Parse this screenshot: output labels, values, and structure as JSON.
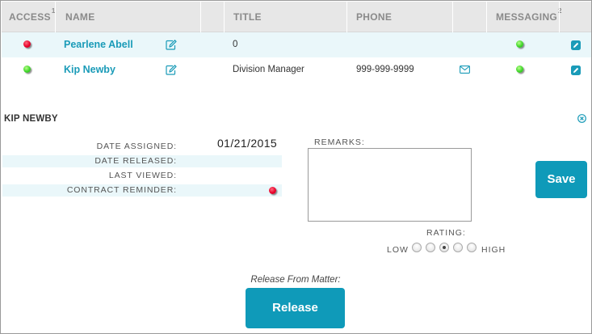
{
  "table": {
    "headers": {
      "access": "ACCESS",
      "access_sup": "1",
      "name": "NAME",
      "title": "TITLE",
      "phone": "PHONE",
      "messaging": "MESSAGING",
      "messaging_sup": "2"
    },
    "rows": [
      {
        "access_status": "red",
        "name": "Pearlene Abell",
        "title": "0",
        "phone": "",
        "has_email": false,
        "messaging_status": "green"
      },
      {
        "access_status": "green",
        "name": "Kip Newby",
        "title": "Division Manager",
        "phone": "999-999-9999",
        "has_email": true,
        "messaging_status": "green"
      }
    ]
  },
  "detail": {
    "title": "KIP NEWBY",
    "fields": {
      "date_assigned_label": "DATE ASSIGNED:",
      "date_assigned_value": "01/21/2015",
      "date_released_label": "DATE RELEASED:",
      "last_viewed_label": "LAST VIEWED:",
      "contract_reminder_label": "CONTRACT REMINDER:",
      "contract_reminder_status": "red"
    },
    "remarks_label": "REMARKS:",
    "remarks_value": "",
    "save_label": "Save",
    "rating_label": "RATING:",
    "rating_low": "LOW",
    "rating_high": "HIGH",
    "rating_selected": 3,
    "rating_max": 5,
    "release_caption": "Release From Matter:",
    "release_label": "Release"
  },
  "colors": {
    "accent": "#0f9ab9",
    "link": "#1a9bb8",
    "status_red": "#e8002a",
    "status_green": "#3fd62a",
    "row_highlight": "#eaf7fa",
    "header_bg": "#e7e7e7"
  },
  "icons": {
    "edit": "edit-pencil-icon",
    "email": "envelope-icon",
    "row_edit": "edit-square-icon",
    "close": "close-circle-icon"
  }
}
